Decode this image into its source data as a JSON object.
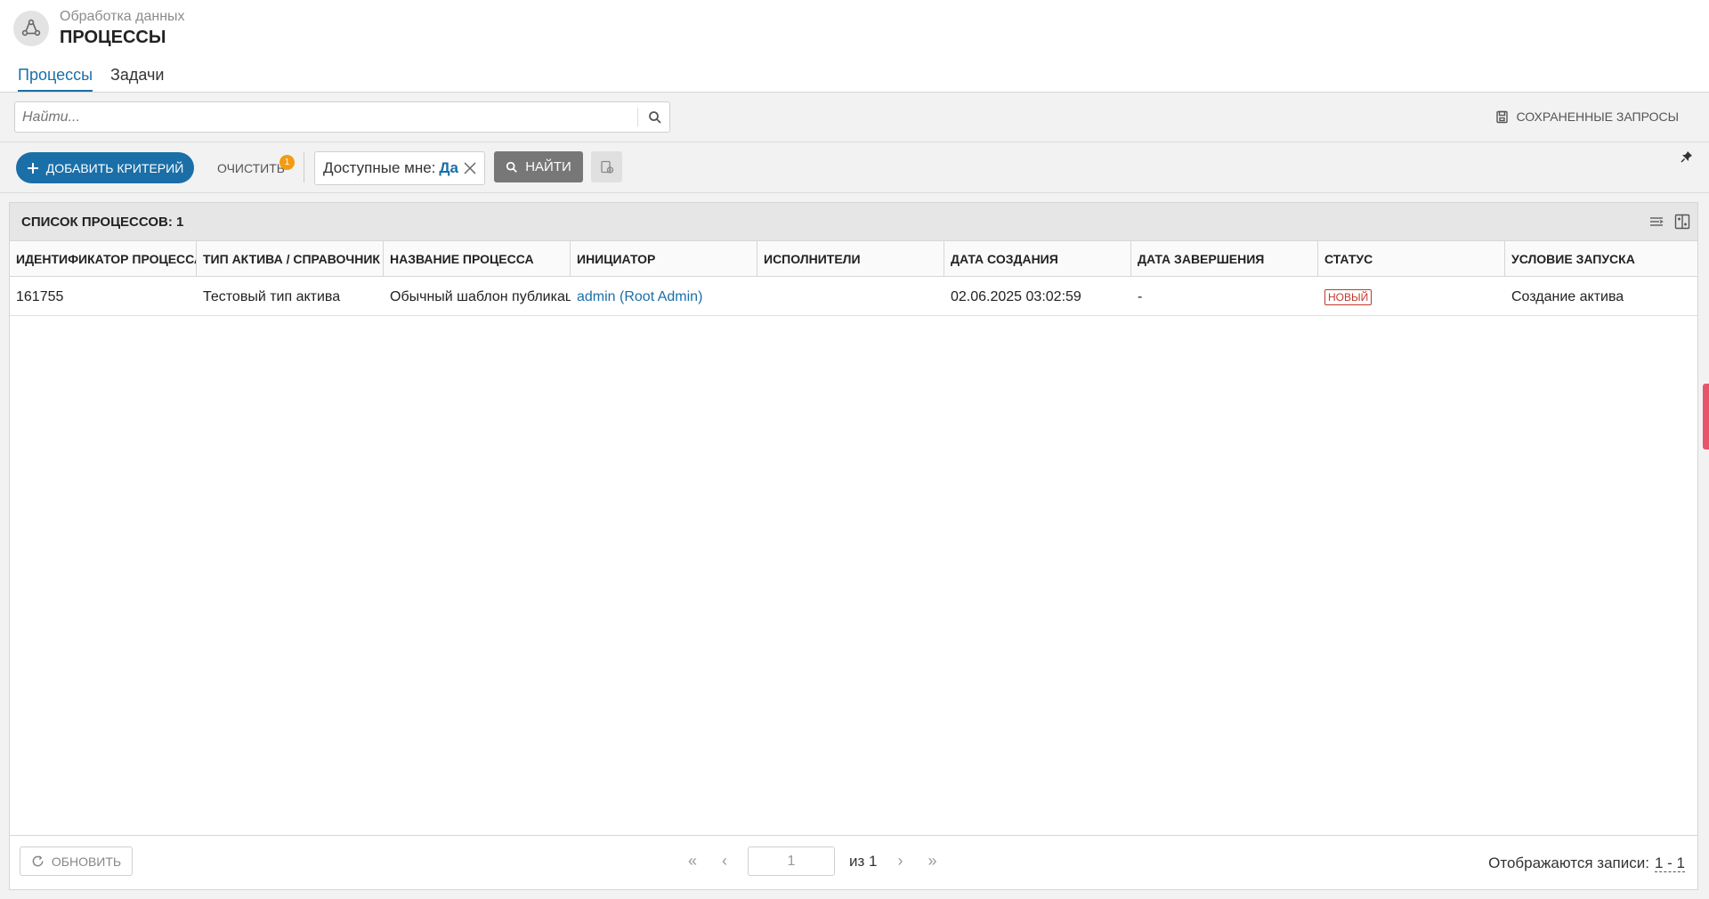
{
  "app": {
    "subtitle": "Обработка данных",
    "title": "ПРОЦЕССЫ",
    "icon": "process-flow-icon"
  },
  "tabs": [
    {
      "label": "Процессы",
      "active": true
    },
    {
      "label": "Задачи",
      "active": false
    }
  ],
  "search": {
    "placeholder": "Найти...",
    "value": "",
    "saved_queries_label": "СОХРАНЕННЫЕ ЗАПРОСЫ"
  },
  "filters": {
    "add_label": "ДОБАВИТЬ КРИТЕРИЙ",
    "clear_label": "ОЧИСТИТЬ",
    "clear_count": "1",
    "chip_label": "Доступные мне:",
    "chip_value": "Да",
    "find_label": "НАЙТИ"
  },
  "panel": {
    "title": "СПИСОК ПРОЦЕССОВ: 1"
  },
  "table": {
    "columns": [
      "ИДЕНТИФИКАТОР ПРОЦЕССА",
      "ТИП АКТИВА / СПРАВОЧНИК",
      "НАЗВАНИЕ ПРОЦЕССА",
      "ИНИЦИАТОР",
      "ИСПОЛНИТЕЛИ",
      "ДАТА СОЗДАНИЯ",
      "ДАТА ЗАВЕРШЕНИЯ",
      "СТАТУС",
      "УСЛОВИЕ ЗАПУСКА"
    ],
    "rows": [
      {
        "id": "161755",
        "asset_type": "Тестовый тип актива",
        "name": "Обычный шаблон публикации",
        "initiator": "admin (Root Admin)",
        "executors": "",
        "created": "02.06.2025 03:02:59",
        "finished": "-",
        "status": "НОВЫЙ",
        "launch_condition": "Создание актива"
      }
    ]
  },
  "footer": {
    "refresh_label": "ОБНОВИТЬ",
    "page": "1",
    "of_label": "из 1",
    "records_label": "Отображаются записи:",
    "records_value": "1 - 1"
  },
  "colors": {
    "accent": "#1a6fa8",
    "status_new": "#c0392b",
    "badge": "#f39c12",
    "side_tab": "#e8546b"
  }
}
